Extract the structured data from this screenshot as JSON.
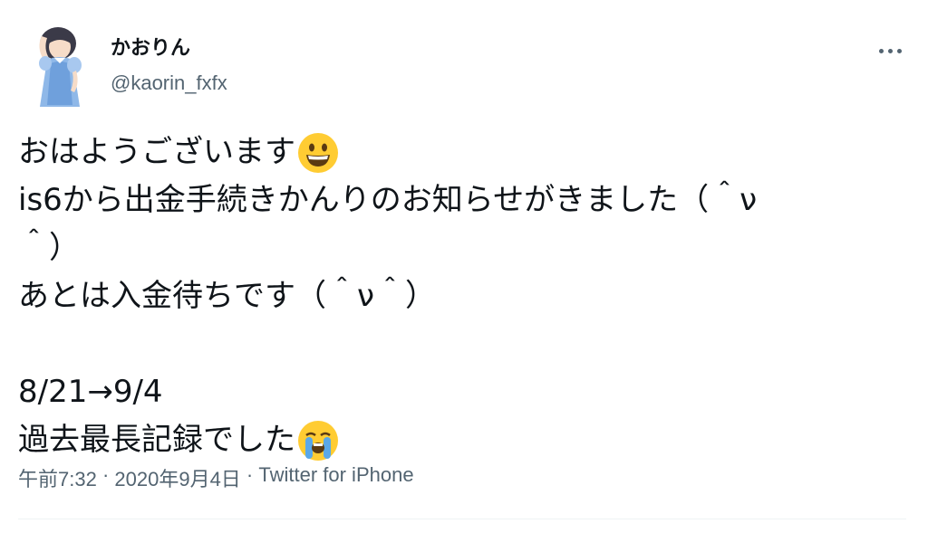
{
  "author": {
    "display_name": "かおりん",
    "handle": "@kaorin_fxfx"
  },
  "tweet": {
    "lines": [
      "おはようございます",
      "is6から出金手続きかんりのお知らせがきました（＾ν",
      "＾）",
      "あとは入金待ちです（＾ν＾）",
      "",
      "8/21→9/4",
      "過去最長記録でした"
    ],
    "emojis": [
      "grinning-face-emoji",
      "loudly-crying-face-emoji"
    ]
  },
  "meta": {
    "time": "午前7:32",
    "separator": " · ",
    "date": "2020年9月4日",
    "source": "Twitter for iPhone"
  },
  "colors": {
    "text": "#0f1419",
    "secondary": "#536471",
    "divider": "#eff3f4",
    "emoji_yellow": "#ffcc33"
  },
  "icons": [
    "more-icon"
  ]
}
